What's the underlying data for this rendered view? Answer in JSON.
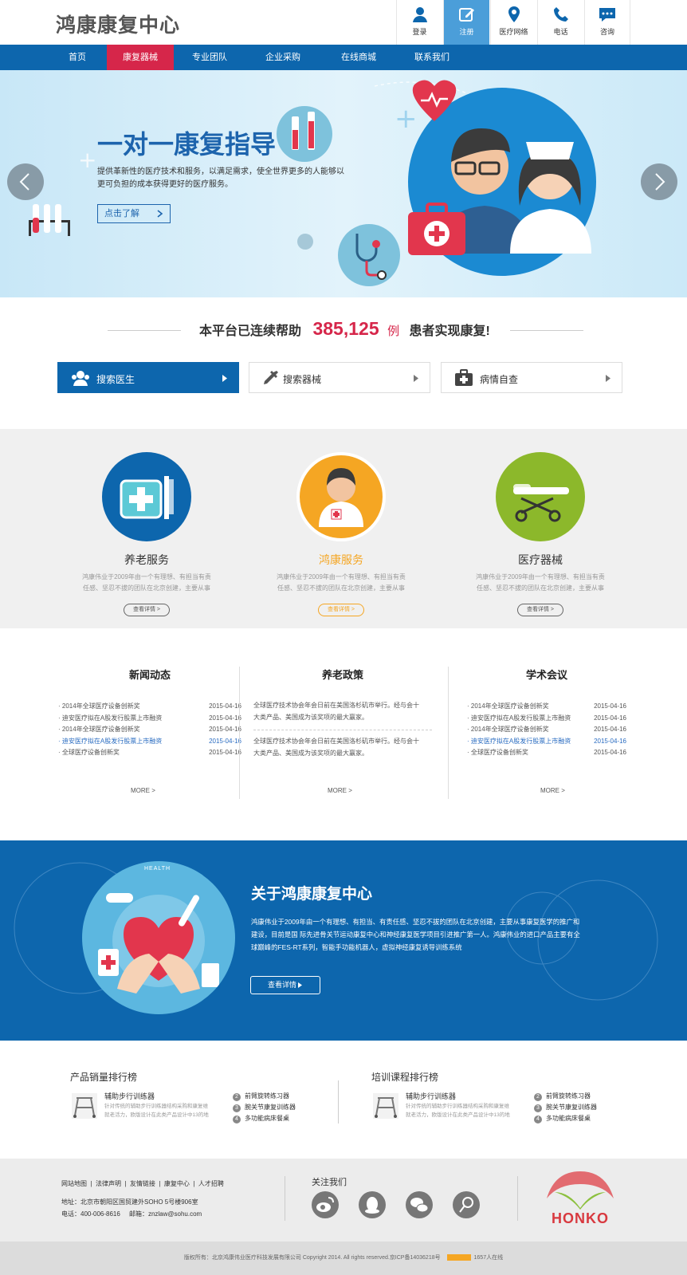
{
  "header": {
    "logo": "鸿康康复中心",
    "tools": [
      {
        "label": "登录",
        "icon": "user-icon"
      },
      {
        "label": "注册",
        "icon": "edit-icon",
        "active": true
      },
      {
        "label": "医疗网络",
        "icon": "location-icon"
      },
      {
        "label": "电话",
        "icon": "phone-icon"
      },
      {
        "label": "咨询",
        "icon": "chat-icon"
      }
    ]
  },
  "nav": {
    "items": [
      {
        "label": "首页"
      },
      {
        "label": "康复器械",
        "active": true
      },
      {
        "label": "专业团队"
      },
      {
        "label": "企业采购"
      },
      {
        "label": "在线商城"
      },
      {
        "label": "联系我们"
      }
    ],
    "search_placeholder": ""
  },
  "banner": {
    "title": "一对一康复指导",
    "desc1": "提供革新性的医疗技术和服务，以满足需求，使全世界更多的人能够以",
    "desc2": "更可负担的成本获得更好的医疗服务。",
    "cta": "点击了解"
  },
  "stats": {
    "prefix": "本平台已连续帮助",
    "number": "385,125",
    "unit": "例",
    "suffix": "患者实现康复!"
  },
  "search_tabs": [
    {
      "label": "搜索医生",
      "icon": "doctor-icon"
    },
    {
      "label": "搜索器械",
      "icon": "syringe-icon"
    },
    {
      "label": "病情自查",
      "icon": "medkit-icon"
    }
  ],
  "services": [
    {
      "title": "养老服务",
      "desc1": "鸿康伟业于2009年由一个有理想、有担当有责",
      "desc2": "任感、坚忍不拔的团队在北京创建，主要从事",
      "btn": "查看详情 >"
    },
    {
      "title": "鸿康服务",
      "desc1": "鸿康伟业于2009年由一个有理想、有担当有责",
      "desc2": "任感、坚忍不拔的团队在北京创建，主要从事",
      "btn": "查看详情 >"
    },
    {
      "title": "医疗器械",
      "desc1": "鸿康伟业于2009年由一个有理想、有担当有责",
      "desc2": "任感、坚忍不拔的团队在北京创建，主要从事",
      "btn": "查看详情 >"
    }
  ],
  "news": {
    "title": "新闻动态",
    "items": [
      {
        "t": "2014年全球医疗设备创新奖",
        "d": "2015-04-16"
      },
      {
        "t": "迪安医疗拟在A股发行股票上市融资",
        "d": "2015-04-16"
      },
      {
        "t": "2014年全球医疗设备创新奖",
        "d": "2015-04-16"
      },
      {
        "t": "迪安医疗拟在A股发行股票上市融资",
        "d": "2015-04-16"
      },
      {
        "t": "全球医疗设备创新奖",
        "d": "2015-04-16"
      }
    ],
    "more": "MORE >"
  },
  "policy": {
    "title": "养老政策",
    "p1a": "全球医疗技术协会年会日前在美国洛杉矶市举行。经与会十",
    "p1b": "大类产品、美国成为该奖项的最大赢家。",
    "p2a": "全球医疗技术协会年会日前在美国洛杉矶市举行。经与会十",
    "p2b": "大类产品、美国成为该奖项的最大赢家。",
    "more": "MORE >"
  },
  "academic": {
    "title": "学术会议",
    "items": [
      {
        "t": "2014年全球医疗设备创新奖",
        "d": "2015-04-16"
      },
      {
        "t": "迪安医疗拟在A股发行股票上市融资",
        "d": "2015-04-16"
      },
      {
        "t": "2014年全球医疗设备创新奖",
        "d": "2015-04-16"
      },
      {
        "t": "迪安医疗拟在A股发行股票上市融资",
        "d": "2015-04-16"
      },
      {
        "t": "全球医疗设备创新奖",
        "d": "2015-04-16"
      }
    ],
    "more": "MORE >"
  },
  "about": {
    "title": "关于鸿康康复中心",
    "l1": "鸿康伟业于2009年由一个有理想、有担当、有责任感、坚忍不拔的团队在北京创建，主要从事康复医学的推广和",
    "l2": "建设，目前是国 际先进骨关节运动康复中心和神经康复医学项目引进推广第一人。鸿康伟业的进口产品主要有全",
    "l3": "球巅峰的FES-RT系列，智能手功能机器人，虚拟神经康复诱导训练系统",
    "btn": "查看详情",
    "health": "HEALTH"
  },
  "rank_products": {
    "title": "产品销量排行榜",
    "top": "辅助步行训练器",
    "td1": "针对传统的辅助步行训练器结构采购和康复维",
    "td2": "就老活力，欧版设计在此类产品设计中13的地",
    "items": [
      {
        "n": "2",
        "t": "前臂旋转练习器"
      },
      {
        "n": "3",
        "t": "腕关节康复训练器"
      },
      {
        "n": "4",
        "t": "多功能病床餐桌"
      }
    ]
  },
  "rank_courses": {
    "title": "培训课程排行榜",
    "top": "辅助步行训练器",
    "td1": "针对传统的辅助步行训练器结构采购和康复维",
    "td2": "就老活力，欧版设计在此类产品设计中13的地",
    "items": [
      {
        "n": "2",
        "t": "前臂旋转练习器"
      },
      {
        "n": "3",
        "t": "腕关节康复训练器"
      },
      {
        "n": "4",
        "t": "多功能病床餐桌"
      }
    ]
  },
  "footer": {
    "links": [
      "网站地图",
      "法律声明",
      "友情链接",
      "康复中心",
      "人才招聘"
    ],
    "address": "地址：北京市朝阳区国贸建外SOHO 5号楼906室",
    "phone": "电话：400-006-8616",
    "email": "邮箱：znzlaw@sohu.com",
    "follow": "关注我们",
    "brand": "HONKO",
    "copyright": "版权所有：北京鸿康伟业医疗科技发展有限公司      Copyright 2014. All rights reserved.京ICP备14036218号",
    "counter": "1657人在线"
  },
  "colors": {
    "primary": "#0d66ad",
    "accent": "#d6264a",
    "orange": "#f5a623",
    "green": "#8cb82b"
  }
}
